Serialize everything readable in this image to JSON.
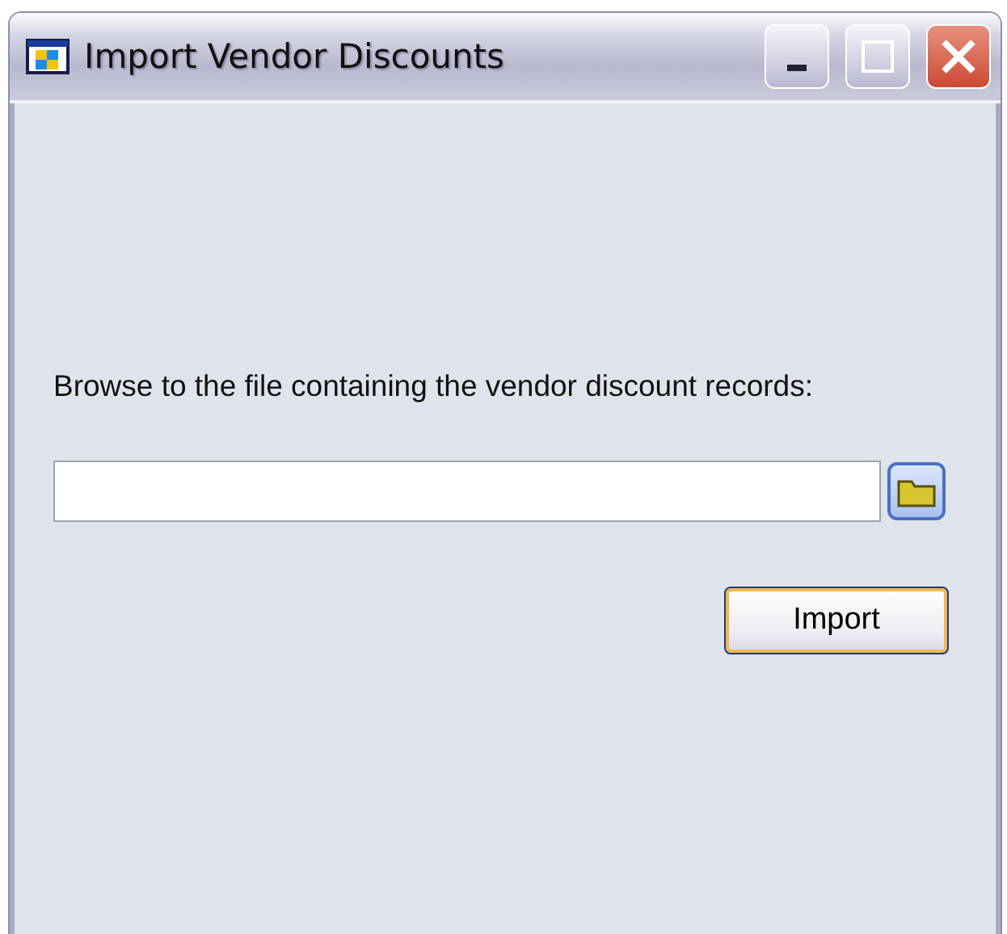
{
  "window": {
    "title": "Import Vendor Discounts"
  },
  "prompt": "Browse to the file containing the vendor discount records:",
  "buttons": [
    {
      "label": "Import",
      "focused": true
    }
  ]
}
